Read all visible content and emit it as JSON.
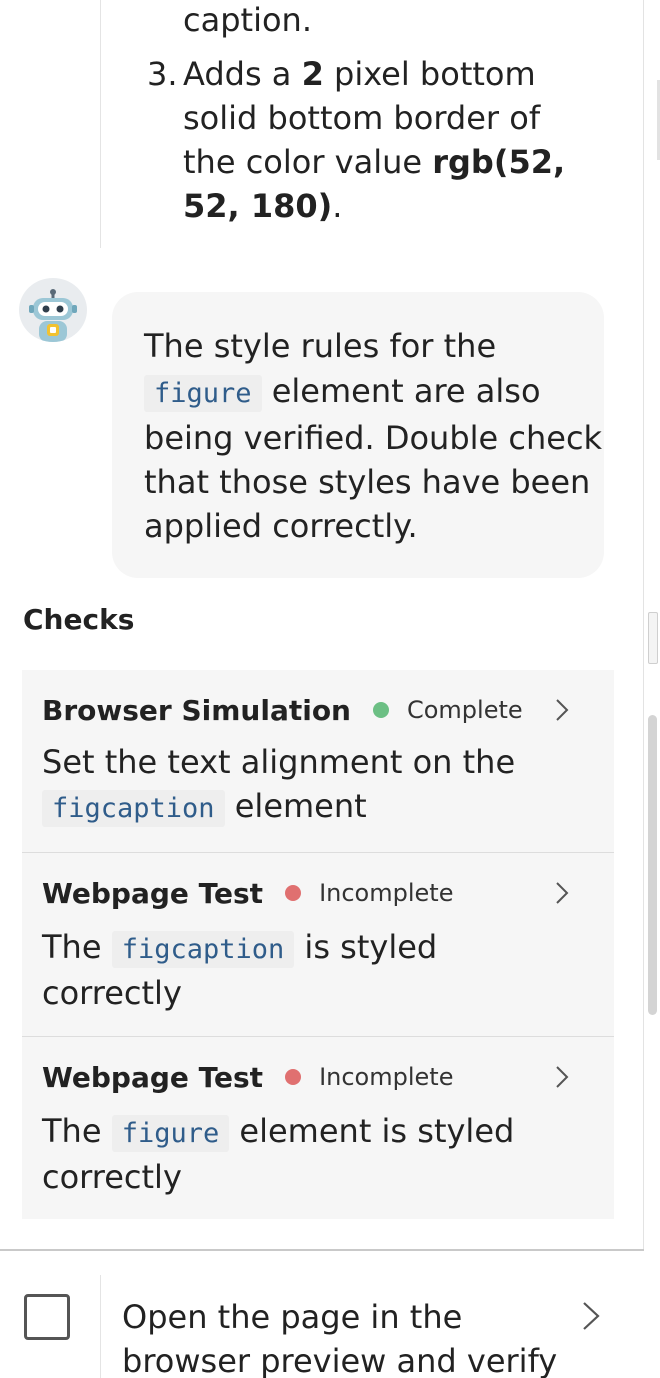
{
  "steps": {
    "caption_tail": "caption.",
    "step3_number": "3.",
    "step3_line1_a": "Adds a ",
    "step3_line1_bold": "2",
    "step3_line1_b": " pixel bottom",
    "step3_line2": "solid bottom border of",
    "step3_line3_a": "the color value ",
    "step3_line3_bold": "rgb(52,",
    "step3_line4_bold": "52, 180)",
    "step3_line4_end": "."
  },
  "message": {
    "avatar_icon": "robot-icon",
    "line1": "The style rules for the",
    "code": "figure",
    "line2_rest": " element are also",
    "line3": "being verified. Double check",
    "line4": "that those styles have been",
    "line5": "applied correctly."
  },
  "checks": {
    "heading": "Checks",
    "colors": {
      "complete": "#6cbf84",
      "incomplete": "#e07070"
    },
    "items": [
      {
        "kind": "Browser Simulation",
        "status": "Complete",
        "line1": "Set the text alignment on the",
        "code": "figcaption",
        "line2_rest": " element"
      },
      {
        "kind": "Webpage Test",
        "status": "Incomplete",
        "line1_pre": "The ",
        "code": "figcaption",
        "line1_post": " is styled",
        "line2": "correctly"
      },
      {
        "kind": "Webpage Test",
        "status": "Incomplete",
        "line1_pre": "The ",
        "code": "figure",
        "line1_post": " element is styled",
        "line2": "correctly"
      }
    ]
  },
  "task": {
    "line1": "Open the page in the",
    "line2": "browser preview and verify"
  }
}
